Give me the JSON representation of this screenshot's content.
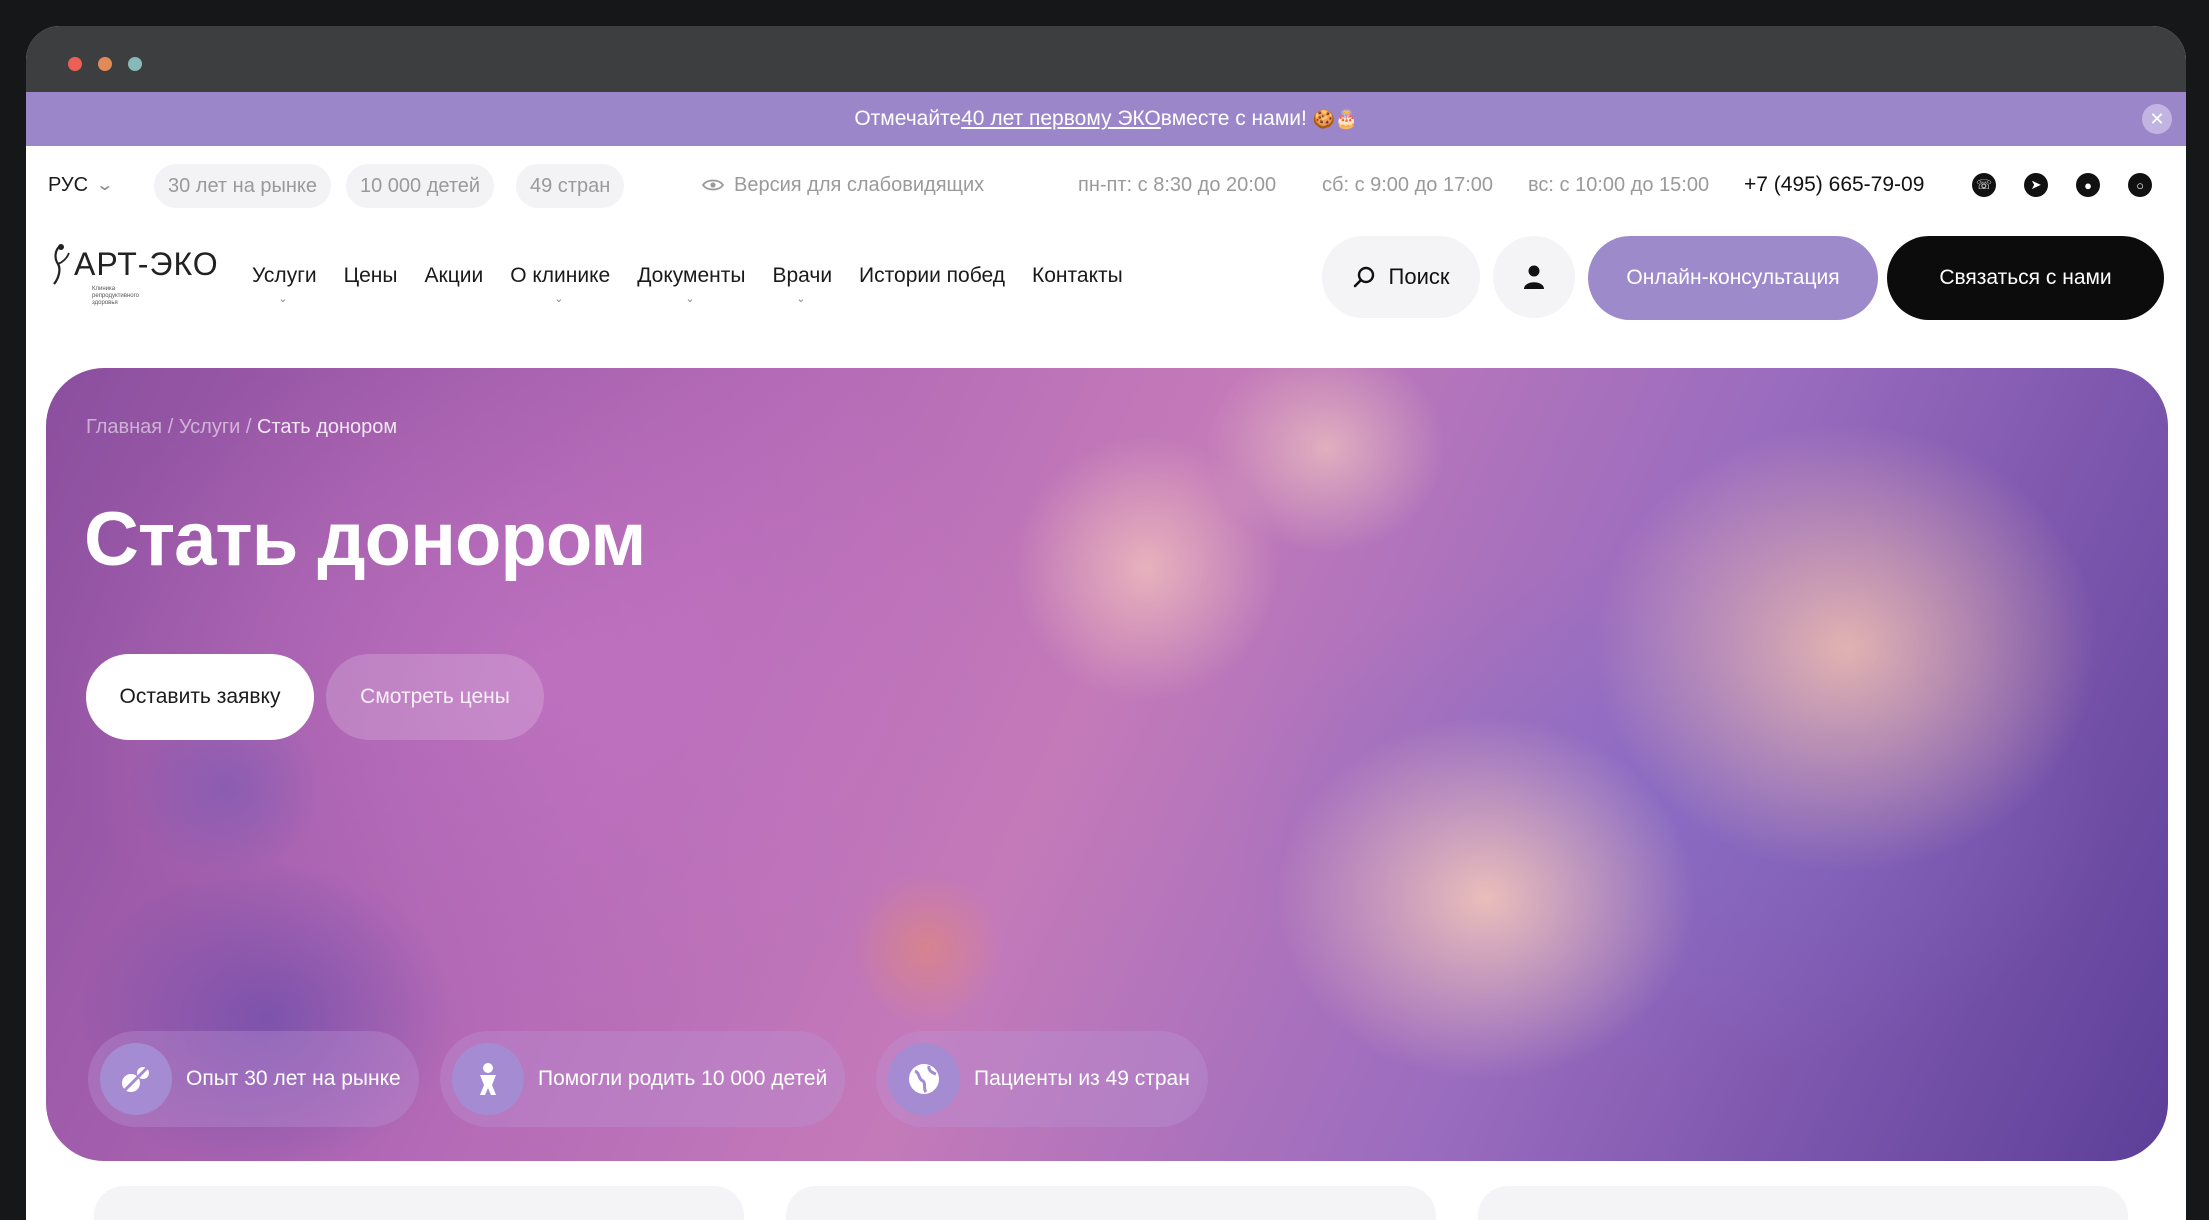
{
  "promo": {
    "text_before": "Отмечайте ",
    "link": "40 лет первому ЭКО",
    "text_after": " вместе с нами!",
    "emoji": "🍪🎂"
  },
  "topbar": {
    "lang": "РУС",
    "pills": [
      "30 лет на рынке",
      "10 000 детей",
      "49 стран"
    ],
    "vision": "Версия для слабовидящих",
    "hours": [
      "пн-пт: с 8:30 до 20:00",
      "сб: с 9:00 до 17:00",
      "вс: с 10:00 до 15:00"
    ],
    "phone": "+7 (495) 665-79-09",
    "socials": [
      "whatsapp-icon",
      "telegram-icon",
      "vk-icon",
      "max-icon"
    ]
  },
  "logo": {
    "text": "АРТ-ЭКО",
    "subtitle": "Клиника репродуктивного здоровья"
  },
  "nav": {
    "items": [
      "Услуги",
      "Цены",
      "Акции",
      "О клинике",
      "Документы",
      "Врачи",
      "Истории побед",
      "Контакты"
    ],
    "search": "Поиск",
    "online": "Онлайн-консультация",
    "contact": "Связаться с нами"
  },
  "hero": {
    "breadcrumb": [
      "Главная",
      "Услуги",
      "Стать донором"
    ],
    "title": "Стать донором",
    "apply": "Оставить заявку",
    "prices": "Смотреть цены",
    "stats": [
      "Опыт 30 лет на рынке",
      "Помогли родить 10 000 детей",
      "Пациенты из 49 стран"
    ]
  },
  "colors": {
    "accent": "#9d8acb",
    "promo_bg": "#9a86c9",
    "dark": "#0c0c0c"
  }
}
